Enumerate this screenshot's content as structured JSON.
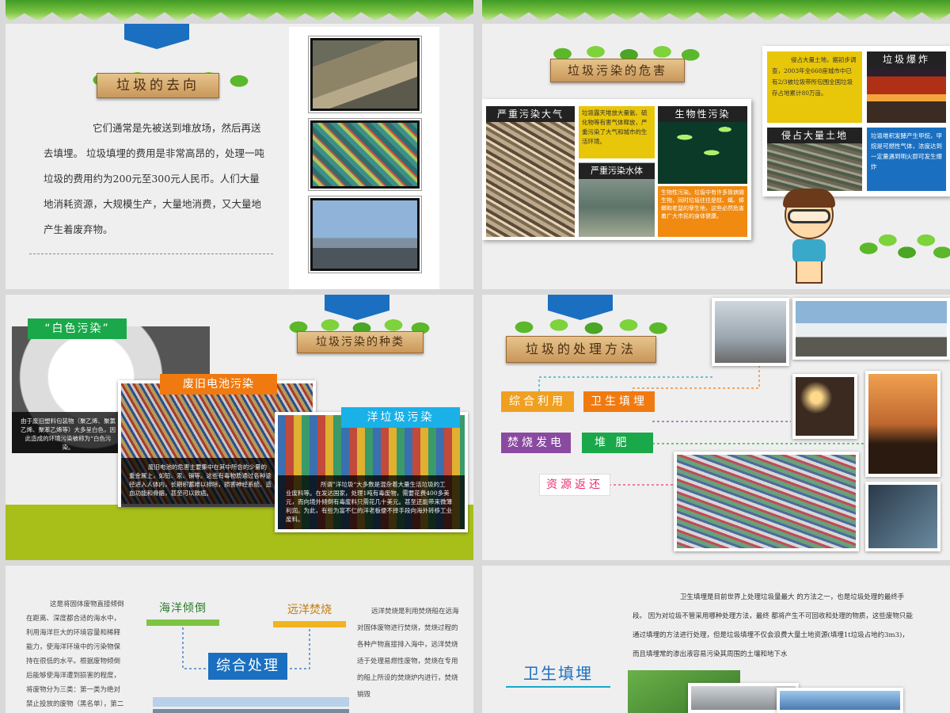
{
  "slide1": {
    "title": "垃圾的去向",
    "paragraph": "它们通常是先被送到堆放场，然后再送去填埋。 垃圾填埋的费用是非常高昂的，处理一吨垃圾的费用约为200元至300元人民币。人们大量地消耗资源，大规模生产，大量地消费，又大量地产生着废弃物。"
  },
  "slide2": {
    "title": "垃圾污染的危害",
    "air": "严重污染大气",
    "air_text": "垃圾露天堆放大量氨、硫化物等有害气体释放，严重污染了大气和城市的生活环境。",
    "bio": "生物性污染",
    "water": "严重污染水体",
    "bio_text": "生物性污染。垃圾中有许多致病微生物，同时垃圾往往是蚊、蝇、蟑螂和老鼠的孳生地，这些必然危害着广大市民的身体健康。",
    "land_text": "侵占大量土地，据初步调查，2003年全668座城市中已有2/3被垃圾带所包围全国垃圾存占地累计80万亩。",
    "explode": "垃圾爆炸",
    "land": "侵占大量土地",
    "explode_text": "垃圾堆积发酵产生甲烷，甲烷是可燃性气体，浓度达到一定量遇到明火即可发生爆炸"
  },
  "slide3": {
    "title": "垃圾污染的种类",
    "white": "“白色污染”",
    "white_text": "由于废旧塑料包装物（聚乙烯、聚氯乙烯、聚苯乙烯等）大多呈白色，因此造成的环境污染被称为“白色污染。",
    "battery": "废旧电池污染",
    "battery_text": "废旧电池的危害主要集中在其中所含的少量的重金属上，如铅、汞、镉等。这些有毒物质通过各种途径进入人体内，长期积蓄难以排除，损害神经系统、造血功能和骨骼，甚至可以致癌。",
    "foreign": "洋垃圾污染",
    "foreign_text1": "所谓”洋垃圾“大多数是混杂着大量生活垃圾的工",
    "foreign_text2": "业废料等。在发达国家，处理1吨有毒废物，需要花费400多美元，而向境外倾倒有毒废料只需花几十美元。甚至还能带来微薄利润。为此，有些为富不仁的洋老板便不择手段向海外转移工业废料。"
  },
  "slide4": {
    "title": "垃圾的处理方法",
    "methods": [
      {
        "label": "综合利用",
        "color": "#f0a020"
      },
      {
        "label": "卫生填埋",
        "color": "#f07a10"
      },
      {
        "label": "焚烧发电",
        "color": "#8a4aa0"
      },
      {
        "label": "堆  肥",
        "color": "#1aa84a"
      },
      {
        "label": "资源返还",
        "color": "#f03a7a"
      }
    ]
  },
  "slide5": {
    "left_text": "这是将固体废物直接倾倒在距离、深度都合适的海水中，利用海洋巨大的环境容量和稀释能力，使海洋环境中的污染物保持在很低的水平。根据废物倾倒后能够使海洋遭到损害的程度，将废物分为三类：第一类为绝对禁止投放的废物（黑名单），第二类是经",
    "ocean": "海洋倾倒",
    "burn": "远洋焚烧",
    "combined": "综合处理",
    "right_text": "远洋焚烧是利用焚烧船在远海对固体废物进行焚烧，焚烧过程的各种产物直接排入海中，远洋焚烧适于处理易燃性废物，焚烧在专用的船上所设的焚烧炉内进行，焚烧销毁"
  },
  "slide6": {
    "paragraph": "卫生填埋是目前世界上处理垃圾量最大  的方法之一，也是垃圾处理的最终手段。       因为对垃圾不管采用哪种处理方法，最终    都将产生不可回收和处理的物质，这些废物只能通过填埋的方法进行处理，但是垃圾填埋不仅会浪费大量土地资源(填埋1t垃圾占地约3m3)，而且填埋常的渗出液容易污染其周围的土壤和地下水",
    "title": "卫生填埋"
  },
  "colors": {
    "blue": "#1a6fc0",
    "green": "#7ec443",
    "olive": "#a8bf1a"
  }
}
